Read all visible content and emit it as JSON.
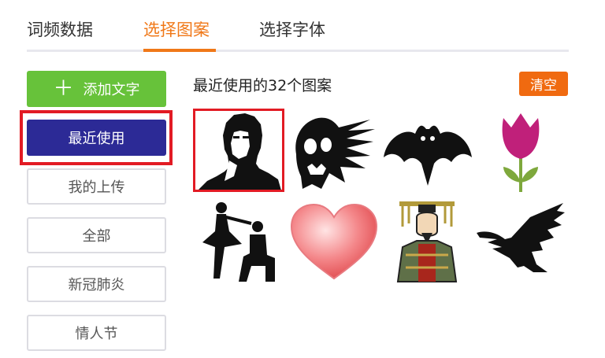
{
  "tabs": [
    {
      "label": "词频数据",
      "active": false
    },
    {
      "label": "选择图案",
      "active": true
    },
    {
      "label": "选择字体",
      "active": false
    }
  ],
  "sidebar": {
    "add_button": {
      "icon": "plus-icon",
      "label": "添加文字"
    },
    "items": [
      {
        "label": "最近使用",
        "active": true
      },
      {
        "label": "我的上传",
        "active": false
      },
      {
        "label": "全部",
        "active": false
      },
      {
        "label": "新冠肺炎",
        "active": false
      },
      {
        "label": "情人节",
        "active": false
      }
    ]
  },
  "main": {
    "title": "最近使用的32个图案",
    "clear_label": "清空",
    "patterns": [
      {
        "name": "man-portrait",
        "selected": true
      },
      {
        "name": "screaming-skull",
        "selected": false
      },
      {
        "name": "bat",
        "selected": false
      },
      {
        "name": "tulip",
        "selected": false
      },
      {
        "name": "proposal-couple",
        "selected": false
      },
      {
        "name": "heart",
        "selected": false
      },
      {
        "name": "emperor",
        "selected": false
      },
      {
        "name": "eagle",
        "selected": false
      }
    ]
  },
  "colors": {
    "accent_orange": "#f07818",
    "add_green": "#67c23a",
    "active_navy": "#2c2a96",
    "highlight_red": "#e21b24",
    "clear_orange": "#f06a10"
  }
}
